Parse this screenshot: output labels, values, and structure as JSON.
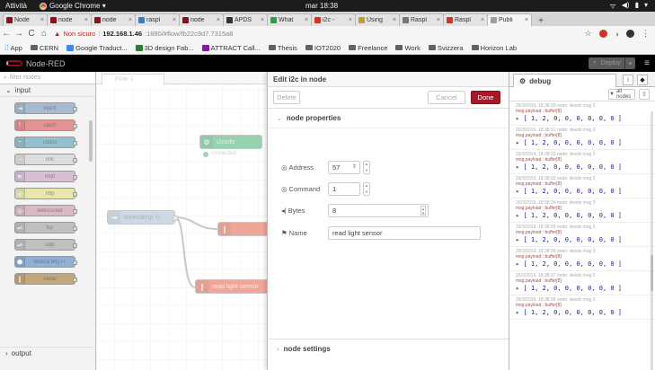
{
  "os": {
    "activities": "Attività",
    "app_name": "Google Chrome ▾",
    "clock": "mar 18:38",
    "tray": [
      "ᯤ",
      "◀)",
      "▮",
      "▾"
    ]
  },
  "tabs": [
    {
      "title": "Node",
      "color": "#8c101c",
      "active": false
    },
    {
      "title": "node",
      "color": "#8c101c",
      "active": false
    },
    {
      "title": "node",
      "color": "#8c101c",
      "active": false
    },
    {
      "title": "raspl",
      "color": "#3b7bbf",
      "active": false
    },
    {
      "title": "node",
      "color": "#8c101c",
      "active": false
    },
    {
      "title": "APDS",
      "color": "#333333",
      "active": false
    },
    {
      "title": "What",
      "color": "#25a244",
      "active": false
    },
    {
      "title": "i2c -",
      "color": "#d93025",
      "active": false
    },
    {
      "title": "Using",
      "color": "#c59b2f",
      "active": false
    },
    {
      "title": "Raspl",
      "color": "#777777",
      "active": false
    },
    {
      "title": "Raspl",
      "color": "#d93025",
      "active": false
    },
    {
      "title": "Publi",
      "color": "#9aa0a6",
      "active": true
    }
  ],
  "newtab": "+",
  "nav": {
    "back": "←",
    "forward": "→",
    "reload": "C",
    "home": "⌂",
    "warning": "▲",
    "not_secure": "Non sicuro",
    "host": "192.168.1.46",
    "path": ":1880/#flow/fb22c9d7.7315a8",
    "star": "☆"
  },
  "bookmarks": [
    {
      "label": "App",
      "kind": "apps"
    },
    {
      "label": "CERN",
      "kind": "folder"
    },
    {
      "label": "Google Traduct...",
      "kind": "translate"
    },
    {
      "label": "3D design Fab...",
      "kind": "site"
    },
    {
      "label": "ATTRACT Call...",
      "kind": "site2"
    },
    {
      "label": "Thesis",
      "kind": "folder"
    },
    {
      "label": "IOT2020",
      "kind": "folder"
    },
    {
      "label": "Freelance",
      "kind": "folder"
    },
    {
      "label": "Work",
      "kind": "folder"
    },
    {
      "label": "Svizzera",
      "kind": "folder"
    },
    {
      "label": "Horizon Lab",
      "kind": "folder"
    }
  ],
  "nodered": {
    "title": "Node-RED",
    "deploy": "Deploy",
    "menu": "≡"
  },
  "palette": {
    "filter_placeholder": "filter nodes",
    "input_category": "input",
    "output_category": "output",
    "nodes": [
      {
        "label": "inject",
        "color": "#a6bbcf",
        "icon": "⇥"
      },
      {
        "label": "catch",
        "color": "#e49191",
        "icon": "!"
      },
      {
        "label": "status",
        "color": "#94c1d0",
        "icon": "~"
      },
      {
        "label": "link",
        "color": "#dddddd",
        "icon": "→"
      },
      {
        "label": "mqtt",
        "color": "#d8bfd8",
        "icon": "≋"
      },
      {
        "label": "http",
        "color": "#e7e7ae",
        "icon": "◎"
      },
      {
        "label": "websocket",
        "color": "#dbb9c3",
        "icon": "◎"
      },
      {
        "label": "tcp",
        "color": "#c0c0c0",
        "icon": "⇌"
      },
      {
        "label": "udp",
        "color": "#c0c0c0",
        "icon": "⇌"
      },
      {
        "label": "Mosca MQTT",
        "color": "#8eb0d5",
        "icon": "⬢"
      },
      {
        "label": "serial",
        "color": "#c2a77a",
        "icon": "∥"
      }
    ]
  },
  "workspace": {
    "flow_tab": "Flow 1",
    "nodes": {
      "inject": "timestamp ⟲",
      "green": "i2cinfo",
      "status_text": "connected",
      "red1": "",
      "red2": "read light sensor"
    }
  },
  "editor": {
    "title": "Edit i2c in node",
    "delete": "Delete",
    "cancel": "Cancel",
    "done": "Done",
    "section_props": "node properties",
    "section_settings": "node settings",
    "address_label": "Address",
    "address_value": "57",
    "command_label": "Command",
    "command_value": "1",
    "bytes_label": "Bytes",
    "bytes_value": "8",
    "name_label": "Name",
    "name_value": "read light sensor"
  },
  "debug": {
    "tab_label": "debug",
    "info": "i",
    "filter": "all nodes",
    "messages": [
      {
        "meta": "26/3/2019, 18:38:30   node: deeds msg 3",
        "topic": "msg.payload : buffer[8]",
        "value": "[ 1, 2, 0, 0, 0, 0, 0, 0 ]"
      },
      {
        "meta": "26/3/2019, 18:38:31   node: deeds msg 3",
        "topic": "msg.payload : buffer[8]",
        "value": "[ 1, 2, 0, 0, 0, 0, 0, 0 ]"
      },
      {
        "meta": "26/3/2019, 18:38:32   node: deeds msg 3",
        "topic": "msg.payload : buffer[8]",
        "value": "[ 1, 2, 0, 0, 0, 0, 0, 0 ]"
      },
      {
        "meta": "26/3/2019, 18:38:33   node: deeds msg 3",
        "topic": "msg.payload : buffer[8]",
        "value": "[ 1, 2, 0, 0, 0, 0, 0, 0 ]"
      },
      {
        "meta": "26/3/2019, 18:38:34   node: deeds msg 3",
        "topic": "msg.payload : buffer[8]",
        "value": "[ 1, 2, 0, 0, 0, 0, 0, 0 ]"
      },
      {
        "meta": "26/3/2019, 18:38:35   node: deeds msg 3",
        "topic": "msg.payload : buffer[8]",
        "value": "[ 1, 2, 0, 0, 0, 0, 0, 0 ]"
      },
      {
        "meta": "26/3/2019, 18:38:36   node: deeds msg 3",
        "topic": "msg.payload : buffer[8]",
        "value": "[ 1, 2, 0, 0, 0, 0, 0, 0 ]"
      },
      {
        "meta": "26/3/2019, 18:38:37   node: deeds msg 3",
        "topic": "msg.payload : buffer[8]",
        "value": "[ 1, 2, 0, 0, 0, 0, 0, 0 ]"
      },
      {
        "meta": "26/3/2019, 18:38:38   node: deeds msg 3",
        "topic": "msg.payload : buffer[8]",
        "value": "[ 1, 2, 0, 0, 0, 0, 0, 0 ]"
      }
    ]
  }
}
